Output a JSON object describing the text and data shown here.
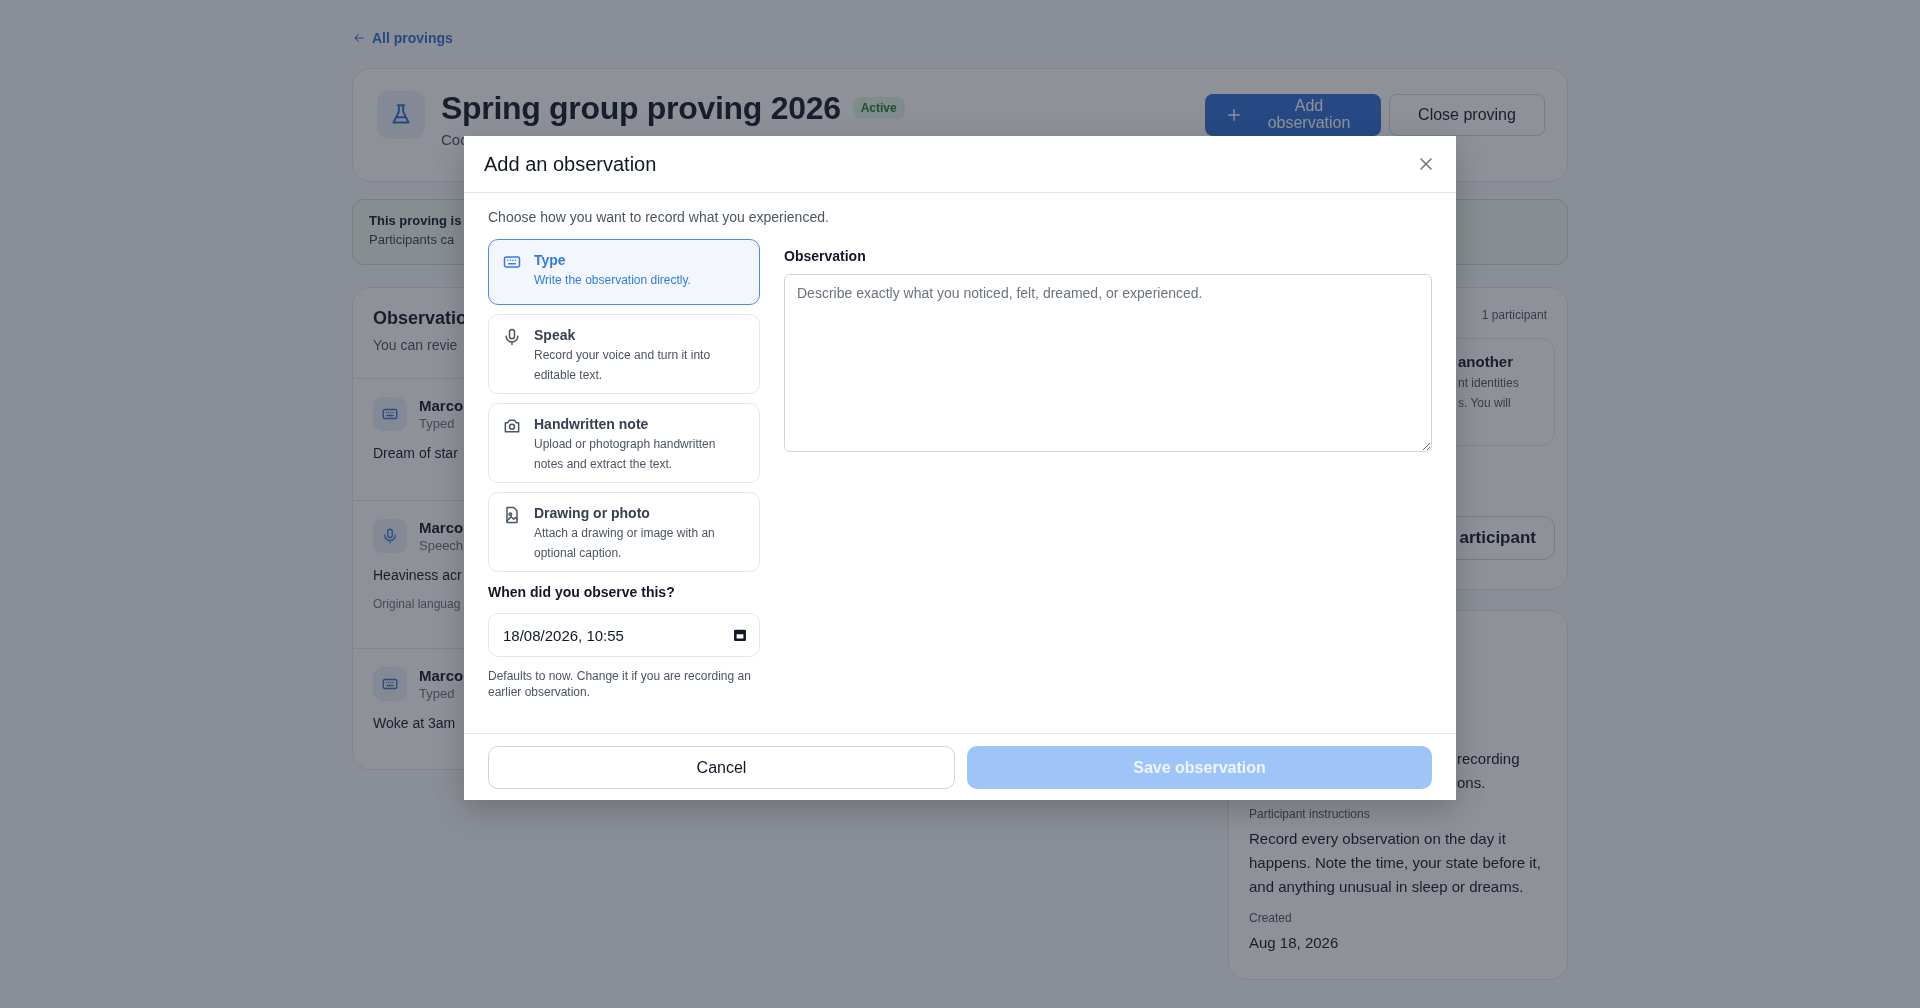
{
  "back_link": "All provings",
  "header": {
    "title": "Spring group proving 2026",
    "status": "Active",
    "subtitle": "Coc",
    "buttons": [
      {
        "label": "Add observation",
        "kind": "primary"
      },
      {
        "label": "Close proving",
        "kind": "secondary"
      }
    ]
  },
  "banner": {
    "title": "This proving is",
    "text": "Participants ca"
  },
  "observations": {
    "title": "Observatio",
    "subtitle": "You can revie",
    "items": [
      {
        "author": "Marco",
        "method": "Typed",
        "kind": "typed",
        "text": "Dream of star"
      },
      {
        "author": "Marco",
        "method": "Speech",
        "kind": "speech",
        "text": "Heaviness acr",
        "note": "Original languag"
      },
      {
        "author": "Marco",
        "method": "Typed",
        "kind": "typed",
        "text": "Woke at 3am"
      }
    ]
  },
  "participants": {
    "count": "1 participant",
    "notice_title": "another",
    "notice_lines": [
      "nt identities",
      "s. You will"
    ],
    "button": "articipant"
  },
  "details": {
    "lines": [
      "recording",
      "ons."
    ],
    "instructions_label": "Participant instructions",
    "instructions": "Record every observation on the day it happens. Note the time, your state before it, and anything unusual in sleep or dreams.",
    "created_label": "Created",
    "created": "Aug 18, 2026"
  },
  "dialog": {
    "title": "Add an observation",
    "intro": "Choose how you want to record what you experienced.",
    "methods": [
      {
        "kind": "type",
        "title": "Type",
        "description": "Write the observation directly.",
        "selected": true
      },
      {
        "kind": "speak",
        "title": "Speak",
        "description": "Record your voice and turn it into editable text.",
        "selected": false
      },
      {
        "kind": "handwritten",
        "title": "Handwritten note",
        "description": "Upload or photograph handwritten notes and extract the text.",
        "selected": false
      },
      {
        "kind": "drawing",
        "title": "Drawing or photo",
        "description": "Attach a drawing or image with an optional caption.",
        "selected": false
      }
    ],
    "observation": {
      "label": "Observation",
      "placeholder": "Describe exactly what you noticed, felt, dreamed, or experienced."
    },
    "when": {
      "label": "When did you observe this?",
      "value": "18/08/2026, 10:55",
      "help": "Defaults to now. Change it if you are recording an earlier observation."
    },
    "buttons": [
      {
        "label": "Cancel",
        "kind": "secondary",
        "disabled": false
      },
      {
        "label": "Save observation",
        "kind": "primary",
        "disabled": true
      }
    ]
  }
}
